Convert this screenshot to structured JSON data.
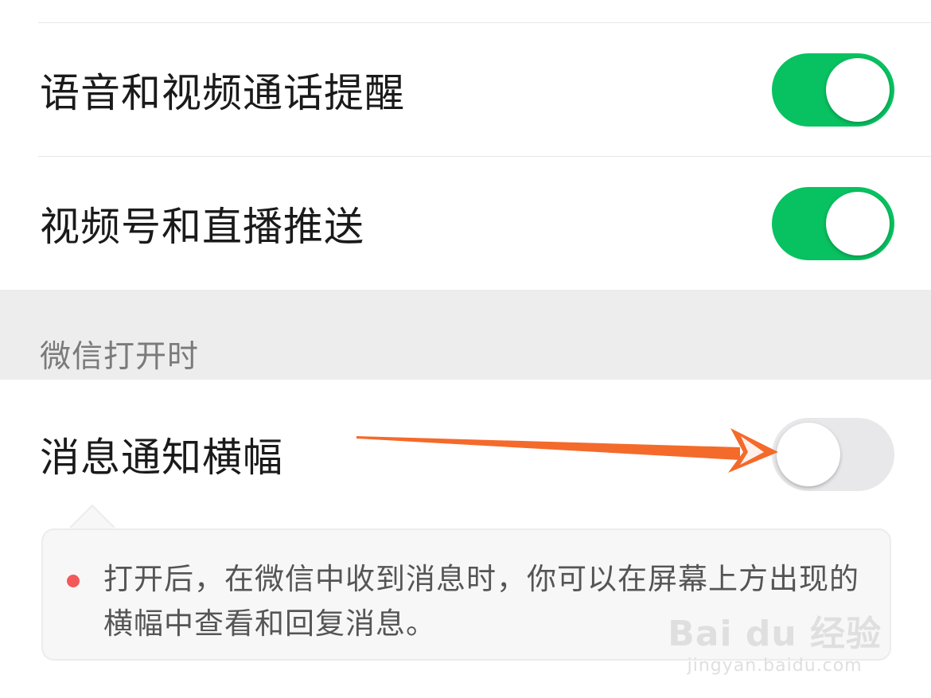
{
  "settings": {
    "rows": [
      {
        "label": "语音和视频通话提醒",
        "enabled": true
      },
      {
        "label": "视频号和直播推送",
        "enabled": true
      }
    ],
    "section": {
      "title": "微信打开时",
      "rows": [
        {
          "label": "消息通知横幅",
          "enabled": false
        }
      ]
    },
    "tip": {
      "text": "打开后，在微信中收到消息时，你可以在屏幕上方出现的横幅中查看和回复消息。"
    }
  },
  "watermark": {
    "logo": "Bai du 经验",
    "url": "jingyan.baidu.com"
  },
  "colors": {
    "accent": "#08c160",
    "toggle_off": "#e8e8ea",
    "arrow": "#f46a2b",
    "tip_dot": "#f25a5a"
  }
}
